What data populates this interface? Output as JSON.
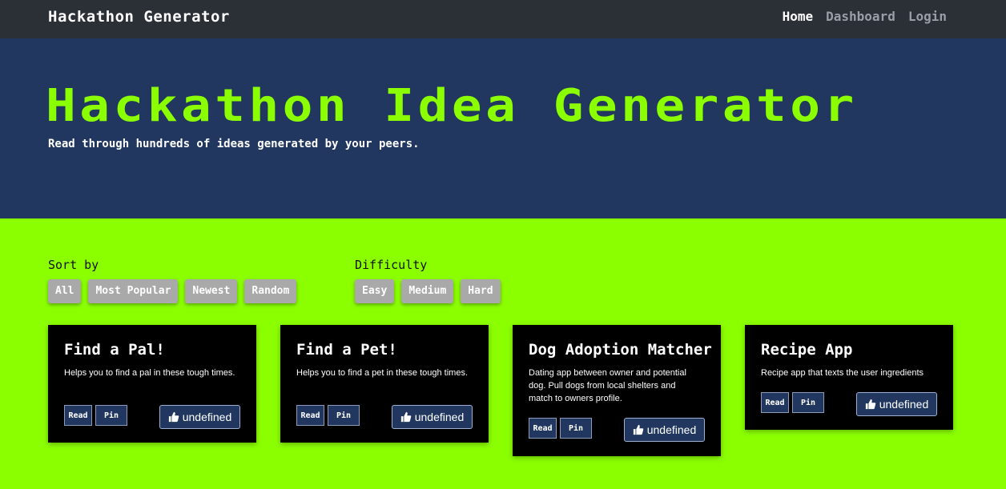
{
  "nav": {
    "brand": "Hackathon Generator",
    "links": [
      {
        "label": "Home"
      },
      {
        "label": "Dashboard"
      },
      {
        "label": "Login"
      }
    ]
  },
  "hero": {
    "title": "Hackathon Idea Generator",
    "subtitle": "Read through hundreds of ideas generated by your peers."
  },
  "sort": {
    "label": "Sort by",
    "options": [
      "All",
      "Most Popular",
      "Newest",
      "Random"
    ]
  },
  "difficulty": {
    "label": "Difficulty",
    "options": [
      "Easy",
      "Medium",
      "Hard"
    ]
  },
  "cards": [
    {
      "title": "Find a Pal!",
      "description": "Helps you to find a pal in these tough times.",
      "read_label": "Read",
      "pin_label": "Pin",
      "likes": "undefined"
    },
    {
      "title": "Find a Pet!",
      "description": "Helps you to find a pet in these tough times.",
      "read_label": "Read",
      "pin_label": "Pin",
      "likes": "undefined"
    },
    {
      "title": "Dog Adoption Matcher",
      "description": "Dating app between owner and potential dog. Pull dogs from local shelters and match to owners profile.",
      "read_label": "Read",
      "pin_label": "Pin",
      "likes": "undefined"
    },
    {
      "title": "Recipe App",
      "description": "Recipe app that texts the user ingredients",
      "read_label": "Read",
      "pin_label": "Pin",
      "likes": "undefined"
    }
  ],
  "colors": {
    "accent": "#8bff00",
    "hero_bg": "#213760",
    "navbar_bg": "#2b2f36",
    "card_bg": "#000000"
  },
  "icons": {
    "like": "thumbs-up-icon"
  }
}
